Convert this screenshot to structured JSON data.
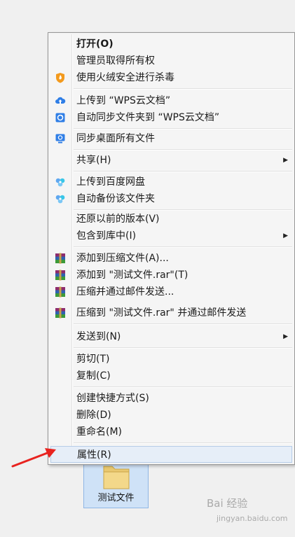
{
  "menu": {
    "items": [
      {
        "label": "打开(O)",
        "icon": "",
        "submenu": false,
        "bold": true
      },
      {
        "label": "管理员取得所有权",
        "icon": "",
        "submenu": false
      },
      {
        "label": "使用火绒安全进行杀毒",
        "icon": "huorong-shield-icon",
        "submenu": false
      },
      {
        "label": "上传到 “WPS云文档”",
        "icon": "cloud-upload-icon",
        "submenu": false
      },
      {
        "label": "自动同步文件夹到 “WPS云文档”",
        "icon": "cloud-sync-icon",
        "submenu": false
      },
      {
        "label": "同步桌面所有文件",
        "icon": "desktop-sync-icon",
        "submenu": false
      },
      {
        "label": "共享(H)",
        "icon": "",
        "submenu": true
      },
      {
        "label": "上传到百度网盘",
        "icon": "baidu-netdisk-icon",
        "submenu": false
      },
      {
        "label": "自动备份该文件夹",
        "icon": "baidu-netdisk-icon",
        "submenu": false
      },
      {
        "label": "还原以前的版本(V)",
        "icon": "",
        "submenu": false
      },
      {
        "label": "包含到库中(I)",
        "icon": "",
        "submenu": true
      },
      {
        "label": "添加到压缩文件(A)...",
        "icon": "winrar-icon",
        "submenu": false
      },
      {
        "label": "添加到 \"测试文件.rar\"(T)",
        "icon": "winrar-icon",
        "submenu": false
      },
      {
        "label": "压缩并通过邮件发送...",
        "icon": "winrar-icon",
        "submenu": false
      },
      {
        "label": "压缩到 \"测试文件.rar\" 并通过邮件发送",
        "icon": "winrar-icon",
        "submenu": false
      },
      {
        "label": "发送到(N)",
        "icon": "",
        "submenu": true
      },
      {
        "label": "剪切(T)",
        "icon": "",
        "submenu": false
      },
      {
        "label": "复制(C)",
        "icon": "",
        "submenu": false
      },
      {
        "label": "创建快捷方式(S)",
        "icon": "",
        "submenu": false
      },
      {
        "label": "删除(D)",
        "icon": "",
        "submenu": false
      },
      {
        "label": "重命名(M)",
        "icon": "",
        "submenu": false
      },
      {
        "label": "属性(R)",
        "icon": "",
        "submenu": false,
        "highlighted": true
      }
    ],
    "submenu_arrow": "▶"
  },
  "folder": {
    "name": "测试文件",
    "icon": "folder-icon"
  },
  "watermark": {
    "text": "Bai 经验",
    "url": "jingyan.baidu.com"
  },
  "annotation": {
    "icon": "red-arrow-icon",
    "color": "#e8231f"
  },
  "colors": {
    "highlight_bg": "#e6eef8",
    "highlight_border": "#b6cce8",
    "menu_bg": "#f5f5f5"
  }
}
